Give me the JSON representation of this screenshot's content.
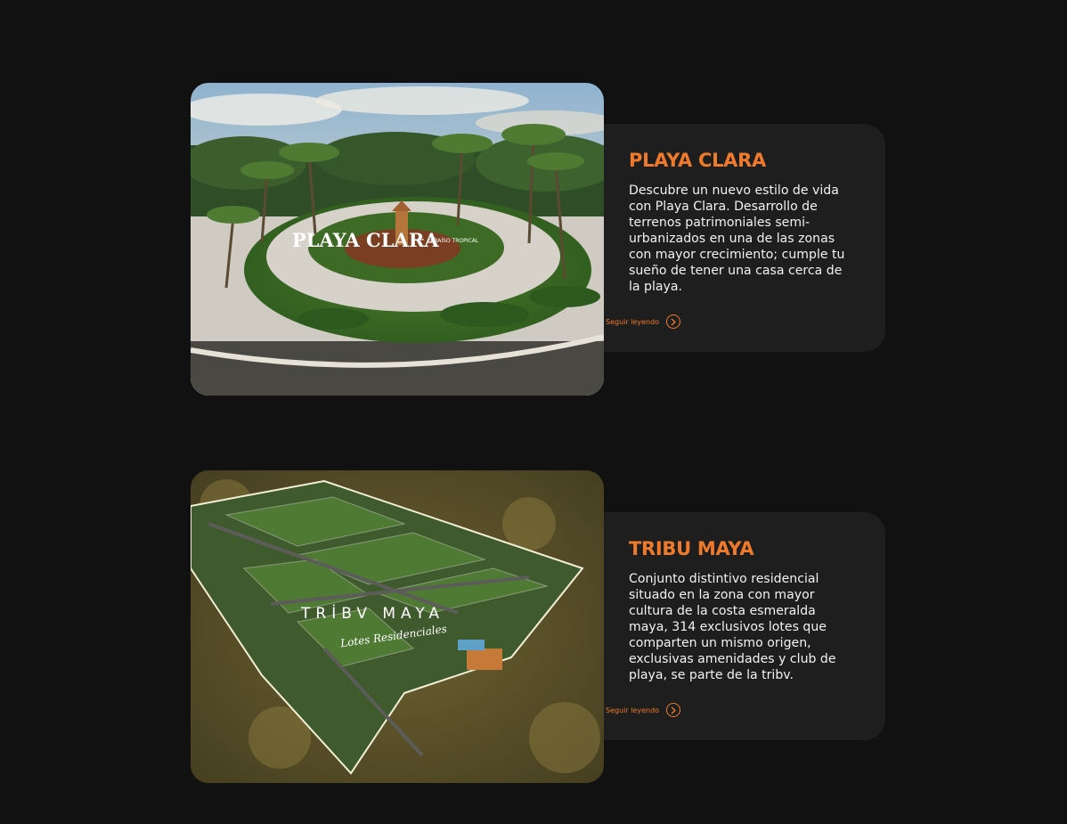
{
  "projects": [
    {
      "title": "PLAYA CLARA",
      "description": "Descubre un nuevo estilo de vida con Playa Clara. Desarrollo de terrenos patrimoniales semi-urbanizados en una de las zonas con mayor crecimiento; cumple tu sueño de tener una casa cerca de la playa.",
      "link_label": "Seguir leyendo",
      "link_icon": "chevron-right-circle-icon",
      "image": {
        "logo": "PLAYA CLARA",
        "tagline": "PARAÍSO TROPICAL"
      }
    },
    {
      "title": "TRIBU MAYA",
      "description": "Conjunto distintivo residencial situado en la zona con mayor cultura de la costa esmeralda maya, 314 exclusivos lotes que comparten un mismo origen, exclusivas amenidades y club de playa, se parte de la tribv.",
      "link_label": "Seguir leyendo",
      "link_icon": "chevron-right-circle-icon",
      "image": {
        "logo": "TRİBV MAYA",
        "tagline": "Lotes Residenciales"
      }
    }
  ],
  "colors": {
    "background": "#121111",
    "card": "#1e1e1e",
    "accent": "#ef7a2b",
    "text": "#f2f2f2"
  }
}
